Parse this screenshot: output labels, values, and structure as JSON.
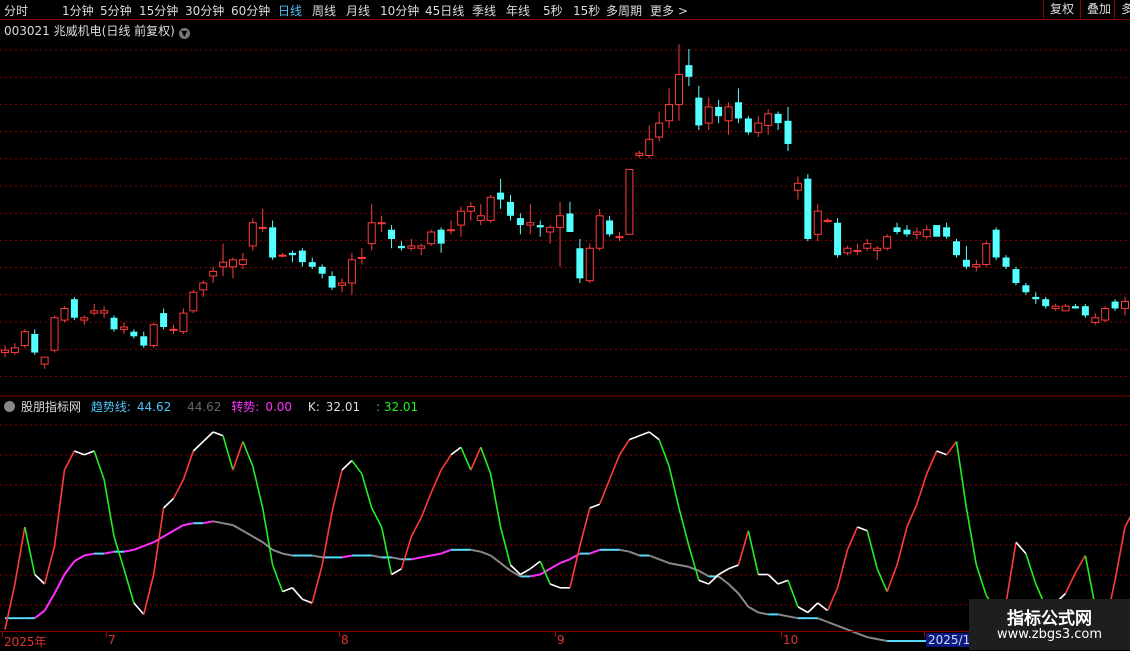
{
  "toolbar": {
    "periods": [
      "分时",
      "1分钟",
      "5分钟",
      "15分钟",
      "30分钟",
      "60分钟",
      "日线",
      "周线",
      "月线",
      "10分钟",
      "45日线",
      "季线",
      "年线",
      "5秒",
      "15秒",
      "多周期",
      "更多 >"
    ],
    "active_period": "日线",
    "right_buttons": [
      "复权",
      "叠加",
      "多"
    ]
  },
  "title": {
    "code": "003021",
    "name": "兆威机电",
    "note": "(日线 前复权)"
  },
  "indicator": {
    "name": "股朋指标网",
    "trend_label": "趋势线:",
    "trend_value": "44.62",
    "trend_value2": "44.62",
    "turn_label": "转势:",
    "turn_value": "0.00",
    "k_label": "K:",
    "k_value": "32.01",
    "k_value2": ": 32.01"
  },
  "xaxis": {
    "labels": [
      "2025年",
      "7",
      "8",
      "9",
      "10",
      "2025/10"
    ]
  },
  "watermark": {
    "line1": "指标公式网",
    "line2": "www.zbgs3.com"
  },
  "colors": {
    "up": "#ff3b3b",
    "down": "#54ffff",
    "grid": "#8b0000",
    "pink": "#ff30ff",
    "green": "#22ee22",
    "gray": "#888888"
  },
  "chart_data": {
    "type": "candlestick",
    "candles": [
      [
        16.6,
        16.9,
        16.4,
        16.7
      ],
      [
        16.6,
        17.0,
        16.5,
        16.8
      ],
      [
        16.9,
        17.6,
        16.8,
        17.5
      ],
      [
        17.4,
        17.6,
        16.5,
        16.6
      ],
      [
        16.1,
        16.4,
        15.9,
        16.4
      ],
      [
        16.7,
        18.2,
        16.6,
        18.1
      ],
      [
        18.0,
        18.6,
        17.9,
        18.5
      ],
      [
        18.9,
        19.0,
        18.0,
        18.1
      ],
      [
        18.0,
        18.2,
        17.8,
        18.1
      ],
      [
        18.3,
        18.7,
        18.2,
        18.4
      ],
      [
        18.3,
        18.6,
        18.1,
        18.4
      ],
      [
        18.1,
        18.2,
        17.5,
        17.6
      ],
      [
        17.6,
        17.9,
        17.4,
        17.7
      ],
      [
        17.5,
        17.6,
        17.2,
        17.3
      ],
      [
        17.3,
        17.5,
        16.8,
        16.9
      ],
      [
        16.9,
        17.9,
        16.8,
        17.8
      ],
      [
        18.3,
        18.5,
        17.6,
        17.7
      ],
      [
        17.6,
        17.8,
        17.4,
        17.6
      ],
      [
        17.5,
        18.5,
        17.4,
        18.3
      ],
      [
        18.4,
        19.3,
        18.3,
        19.2
      ],
      [
        19.3,
        19.7,
        19.0,
        19.6
      ],
      [
        19.9,
        20.3,
        19.6,
        20.1
      ],
      [
        20.3,
        21.3,
        19.9,
        20.5
      ],
      [
        20.3,
        20.7,
        19.8,
        20.6
      ],
      [
        20.4,
        20.9,
        20.2,
        20.6
      ],
      [
        21.2,
        22.4,
        21.0,
        22.2
      ],
      [
        22.0,
        22.8,
        21.8,
        22.0
      ],
      [
        22.0,
        22.3,
        20.6,
        20.7
      ],
      [
        20.8,
        20.9,
        20.7,
        20.8
      ],
      [
        20.9,
        21.0,
        20.5,
        20.8
      ],
      [
        21.0,
        21.1,
        20.3,
        20.5
      ],
      [
        20.5,
        20.7,
        20.2,
        20.3
      ],
      [
        20.3,
        20.4,
        19.8,
        20.0
      ],
      [
        19.9,
        20.1,
        19.3,
        19.4
      ],
      [
        19.5,
        19.8,
        19.2,
        19.6
      ],
      [
        19.6,
        20.9,
        19.1,
        20.6
      ],
      [
        20.7,
        21.1,
        20.4,
        20.7
      ],
      [
        21.3,
        23.0,
        21.0,
        22.2
      ],
      [
        22.2,
        22.5,
        21.8,
        22.2
      ],
      [
        21.9,
        22.1,
        21.1,
        21.5
      ],
      [
        21.2,
        21.4,
        21.0,
        21.1
      ],
      [
        21.1,
        21.5,
        21.0,
        21.2
      ],
      [
        21.1,
        21.3,
        20.8,
        21.2
      ],
      [
        21.3,
        21.9,
        21.2,
        21.8
      ],
      [
        21.9,
        22.0,
        20.9,
        21.3
      ],
      [
        21.9,
        22.3,
        21.7,
        21.9
      ],
      [
        22.1,
        22.9,
        21.6,
        22.7
      ],
      [
        22.7,
        23.1,
        22.3,
        22.9
      ],
      [
        22.3,
        23.0,
        22.1,
        22.5
      ],
      [
        22.3,
        23.4,
        22.2,
        23.3
      ],
      [
        23.5,
        24.1,
        22.8,
        23.2
      ],
      [
        23.1,
        23.4,
        22.3,
        22.5
      ],
      [
        22.4,
        22.6,
        21.7,
        22.1
      ],
      [
        22.1,
        23.0,
        21.7,
        22.2
      ],
      [
        22.1,
        22.3,
        21.6,
        22.0
      ],
      [
        21.8,
        22.1,
        21.3,
        22.0
      ],
      [
        22.0,
        23.1,
        20.3,
        22.5
      ],
      [
        22.6,
        23.1,
        21.8,
        21.8
      ],
      [
        21.1,
        21.5,
        19.6,
        19.8
      ],
      [
        19.7,
        21.3,
        19.6,
        21.1
      ],
      [
        21.1,
        22.8,
        21.0,
        22.5
      ],
      [
        22.3,
        22.5,
        21.6,
        21.7
      ],
      [
        21.6,
        21.8,
        21.4,
        21.6
      ],
      [
        21.7,
        24.5,
        21.7,
        24.5
      ],
      [
        25.1,
        25.3,
        25.0,
        25.2
      ],
      [
        25.1,
        26.4,
        25.0,
        25.8
      ],
      [
        25.9,
        27.0,
        25.7,
        26.5
      ],
      [
        26.6,
        28.0,
        26.3,
        27.3
      ],
      [
        27.3,
        29.9,
        26.6,
        28.6
      ],
      [
        29.0,
        29.7,
        28.1,
        28.5
      ],
      [
        27.6,
        28.1,
        26.2,
        26.4
      ],
      [
        26.5,
        27.6,
        26.2,
        27.2
      ],
      [
        27.2,
        27.5,
        26.5,
        26.8
      ],
      [
        26.6,
        27.4,
        26.0,
        27.2
      ],
      [
        27.4,
        28.0,
        26.5,
        26.7
      ],
      [
        26.7,
        26.8,
        26.0,
        26.1
      ],
      [
        26.1,
        26.8,
        25.9,
        26.5
      ],
      [
        26.4,
        27.1,
        26.0,
        26.9
      ],
      [
        26.9,
        27.0,
        26.2,
        26.5
      ],
      [
        26.6,
        27.2,
        25.3,
        25.6
      ],
      [
        23.6,
        24.2,
        23.2,
        23.9
      ],
      [
        24.1,
        24.3,
        21.4,
        21.5
      ],
      [
        21.7,
        23.0,
        21.4,
        22.7
      ],
      [
        22.3,
        22.4,
        22.2,
        22.3
      ],
      [
        22.2,
        22.4,
        20.7,
        20.8
      ],
      [
        20.9,
        21.2,
        20.8,
        21.1
      ],
      [
        21.0,
        21.3,
        20.8,
        21.0
      ],
      [
        21.1,
        21.5,
        21.0,
        21.3
      ],
      [
        21.0,
        21.2,
        20.6,
        21.1
      ],
      [
        21.1,
        21.7,
        21.0,
        21.6
      ],
      [
        22.0,
        22.2,
        21.7,
        21.8
      ],
      [
        21.9,
        22.1,
        21.6,
        21.7
      ],
      [
        21.7,
        22.0,
        21.5,
        21.8
      ],
      [
        21.6,
        22.1,
        21.5,
        21.9
      ],
      [
        22.1,
        22.1,
        21.6,
        21.6
      ],
      [
        22.0,
        22.2,
        21.5,
        21.6
      ],
      [
        21.4,
        21.5,
        20.7,
        20.8
      ],
      [
        20.6,
        21.2,
        20.2,
        20.3
      ],
      [
        20.3,
        20.6,
        20.1,
        20.4
      ],
      [
        20.4,
        21.4,
        20.3,
        21.3
      ],
      [
        21.9,
        22.0,
        20.6,
        20.7
      ],
      [
        20.7,
        20.8,
        20.2,
        20.3
      ],
      [
        20.2,
        20.3,
        19.5,
        19.6
      ],
      [
        19.5,
        19.6,
        19.1,
        19.2
      ],
      [
        19.0,
        19.2,
        18.7,
        18.9
      ],
      [
        18.9,
        19.0,
        18.5,
        18.6
      ],
      [
        18.5,
        18.7,
        18.4,
        18.6
      ],
      [
        18.4,
        18.7,
        18.4,
        18.6
      ],
      [
        18.6,
        18.7,
        18.5,
        18.5
      ],
      [
        18.6,
        18.7,
        18.1,
        18.2
      ],
      [
        17.9,
        18.3,
        17.8,
        18.1
      ],
      [
        18.0,
        18.6,
        17.9,
        18.5
      ],
      [
        18.8,
        18.9,
        18.4,
        18.5
      ],
      [
        18.5,
        19.0,
        18.2,
        18.8
      ]
    ],
    "k_line": [
      -4,
      20,
      50,
      25,
      20,
      40,
      80,
      90,
      88,
      90,
      75,
      45,
      28,
      10,
      4,
      25,
      60,
      65,
      75,
      90,
      95,
      100,
      98,
      80,
      95,
      82,
      60,
      30,
      16,
      18,
      12,
      10,
      30,
      58,
      80,
      85,
      78,
      60,
      50,
      25,
      28,
      45,
      55,
      68,
      80,
      88,
      92,
      80,
      92,
      78,
      50,
      30,
      25,
      28,
      32,
      20,
      18,
      18,
      40,
      60,
      62,
      75,
      88,
      96,
      98,
      100,
      96,
      82,
      60,
      40,
      22,
      20,
      25,
      28,
      30,
      48,
      25,
      25,
      20,
      22,
      8,
      5,
      10,
      6,
      18,
      38,
      50,
      48,
      28,
      16,
      30,
      50,
      62,
      78,
      90,
      88,
      95,
      60,
      30,
      14,
      6,
      10,
      42,
      36,
      20,
      8,
      10,
      15,
      26,
      35,
      8,
      -2,
      22,
      50,
      60,
      62
    ],
    "trend_line": [
      2,
      2,
      2,
      2,
      6,
      15,
      25,
      32,
      35,
      36,
      36,
      37,
      37,
      38,
      40,
      42,
      45,
      48,
      51,
      52,
      52,
      53,
      52,
      51,
      48,
      45,
      42,
      38,
      36,
      35,
      35,
      35,
      34,
      34,
      34,
      35,
      35,
      35,
      34,
      34,
      33,
      33,
      34,
      35,
      36,
      38,
      38,
      38,
      37,
      35,
      31,
      27,
      24,
      24,
      25,
      28,
      31,
      33,
      36,
      36,
      38,
      38,
      38,
      37,
      35,
      35,
      33,
      31,
      30,
      29,
      27,
      24,
      24,
      20,
      15,
      8,
      5,
      4,
      4,
      3,
      2,
      2,
      2,
      0,
      -2,
      -4,
      -6,
      -8,
      -9,
      -10,
      -10,
      -10,
      -10,
      -10,
      -10,
      -10,
      -10,
      -10,
      -10,
      -10,
      -10,
      -10,
      -10,
      -10,
      -10,
      -10,
      -10,
      -10,
      -10,
      -10,
      -10,
      -10,
      -10,
      -10,
      -10
    ]
  }
}
